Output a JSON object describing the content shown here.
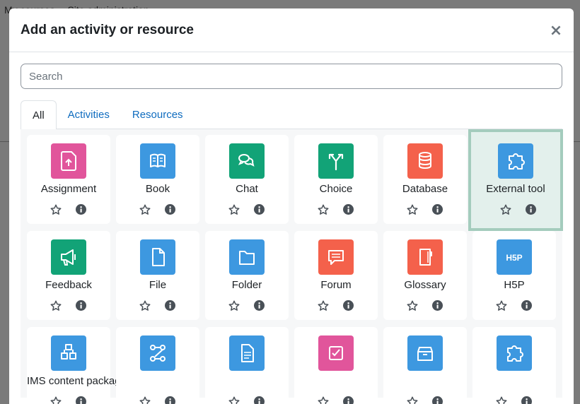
{
  "background": {
    "breadcrumb": [
      "My courses",
      "Site administration"
    ]
  },
  "modal": {
    "title": "Add an activity or resource",
    "close_symbol": "×",
    "search_placeholder": "Search"
  },
  "tabs": [
    {
      "label": "All",
      "active": true
    },
    {
      "label": "Activities",
      "active": false
    },
    {
      "label": "Resources",
      "active": false
    }
  ],
  "colors": {
    "pink": "#e1559b",
    "blue": "#3d98e0",
    "green": "#12a377",
    "orange": "#f4614b",
    "link": "#0f6cbf",
    "selected_bg": "#e3f0ec",
    "selected_border": "#a4ccbd"
  },
  "tiles": [
    {
      "label": "Assignment",
      "icon": "assignment-icon",
      "color": "#e1559b",
      "selected": false
    },
    {
      "label": "Book",
      "icon": "book-icon",
      "color": "#3d98e0",
      "selected": false
    },
    {
      "label": "Chat",
      "icon": "chat-icon",
      "color": "#12a377",
      "selected": false
    },
    {
      "label": "Choice",
      "icon": "choice-icon",
      "color": "#12a377",
      "selected": false
    },
    {
      "label": "Database",
      "icon": "database-icon",
      "color": "#f4614b",
      "selected": false
    },
    {
      "label": "External tool",
      "icon": "puzzle-icon",
      "color": "#3d98e0",
      "selected": true
    },
    {
      "label": "Feedback",
      "icon": "megaphone-icon",
      "color": "#12a377",
      "selected": false
    },
    {
      "label": "File",
      "icon": "file-icon",
      "color": "#3d98e0",
      "selected": false
    },
    {
      "label": "Folder",
      "icon": "folder-icon",
      "color": "#3d98e0",
      "selected": false
    },
    {
      "label": "Forum",
      "icon": "forum-icon",
      "color": "#f4614b",
      "selected": false
    },
    {
      "label": "Glossary",
      "icon": "glossary-icon",
      "color": "#f4614b",
      "selected": false
    },
    {
      "label": "H5P",
      "icon": "h5p-icon",
      "color": "#3d98e0",
      "selected": false
    },
    {
      "label": "IMS content package",
      "icon": "package-icon",
      "color": "#3d98e0",
      "selected": false
    },
    {
      "label": "",
      "icon": "lesson-icon",
      "color": "#3d98e0",
      "selected": false
    },
    {
      "label": "",
      "icon": "page-icon",
      "color": "#3d98e0",
      "selected": false
    },
    {
      "label": "",
      "icon": "quiz-icon",
      "color": "#e1559b",
      "selected": false
    },
    {
      "label": "",
      "icon": "box-icon",
      "color": "#3d98e0",
      "selected": false
    },
    {
      "label": "",
      "icon": "puzzle-icon",
      "color": "#3d98e0",
      "selected": false
    }
  ]
}
